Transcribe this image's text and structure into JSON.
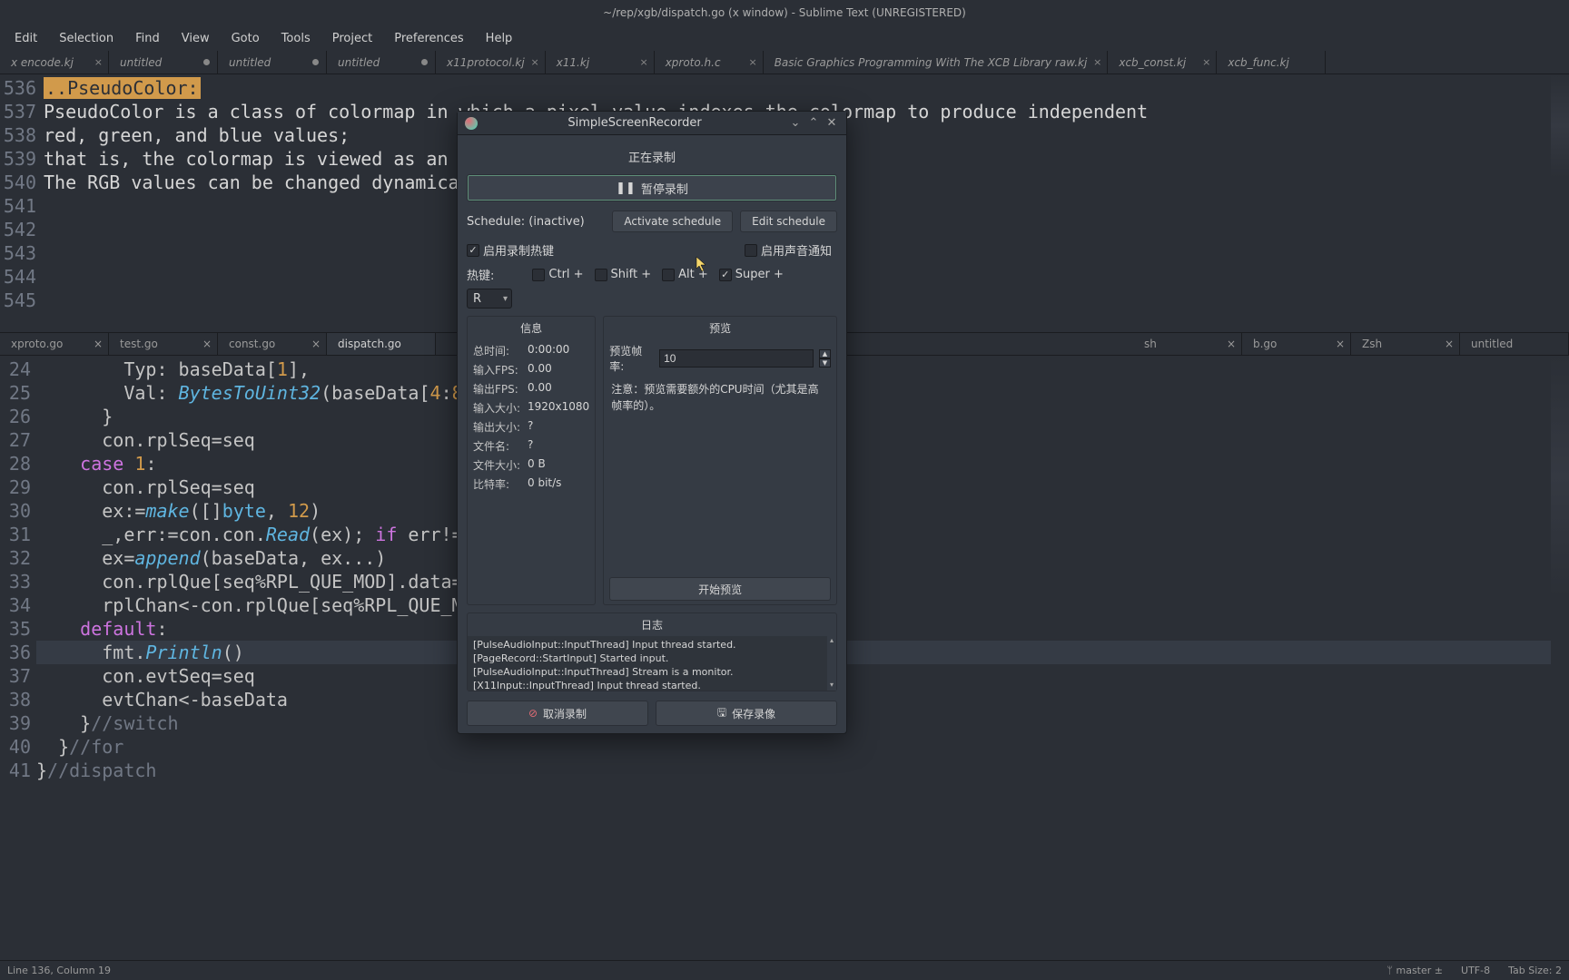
{
  "window_title": "~/rep/xgb/dispatch.go (x window) - Sublime Text (UNREGISTERED)",
  "menu": [
    "Edit",
    "Selection",
    "Find",
    "View",
    "Goto",
    "Tools",
    "Project",
    "Preferences",
    "Help"
  ],
  "tabs_top": [
    {
      "label": "x encode.kj",
      "close": "×"
    },
    {
      "label": "untitled",
      "dirty": true
    },
    {
      "label": "untitled",
      "dirty": true
    },
    {
      "label": "untitled",
      "dirty": true
    },
    {
      "label": "x11protocol.kj",
      "close": "×"
    },
    {
      "label": "x11.kj",
      "close": "×"
    },
    {
      "label": "xproto.h.c",
      "close": "×"
    },
    {
      "label": "Basic Graphics Programming With The XCB Library raw.kj",
      "close": "×"
    },
    {
      "label": "xcb_const.kj",
      "close": "×"
    },
    {
      "label": "xcb_func.kj"
    }
  ],
  "editor_top": {
    "gutter": [
      "536",
      "537",
      "538",
      "539",
      "540",
      "541",
      "542",
      "543",
      "",
      "544",
      "545"
    ],
    "lines": [
      "",
      "",
      "",
      "",
      "",
      "@HL@..PseudoColor:@HL@",
      "",
      "PseudoColor is a class of colormap in which a pixel value indexes the colormap to produce independent",
      "red, green, and blue values;",
      "that is, the colormap is viewed as an array of triples (RGB values).",
      "The RGB values can be changed dynamically."
    ]
  },
  "tabs_bottom": [
    {
      "label": "xproto.go",
      "close": "×"
    },
    {
      "label": "test.go",
      "close": "×"
    },
    {
      "label": "const.go",
      "close": "×"
    },
    {
      "label": "dispatch.go",
      "active": true
    },
    {
      "label": "",
      "spacer": true
    },
    {
      "label": "sh",
      "close": "×"
    },
    {
      "label": "b.go",
      "close": "×"
    },
    {
      "label": "Zsh",
      "close": "×"
    },
    {
      "label": "untitled"
    }
  ],
  "editor_bottom": {
    "gutter": [
      "24",
      "25",
      "26",
      "27",
      "28",
      "29",
      "30",
      "31",
      "32",
      "33",
      "34",
      "35",
      "36",
      "37",
      "38",
      "39",
      "40",
      "41"
    ],
    "lines_html": [
      "        Typ: baseData[<span class='tok-num'>1</span>],",
      "        Val: <span class='tok-fn'>BytesToUint32</span>(baseData[<span class='tok-num'>4</span>:<span class='tok-num'>8</span>]),",
      "      }",
      "      con.rplSeq=seq",
      "    <span class='tok-kw'>case</span> <span class='tok-num'>1</span>:",
      "      con.rplSeq=seq",
      "      ex:=<span class='tok-fn'>make</span>([]<span class='tok-type'>byte</span>, <span class='tok-num'>12</span>)",
      "      _,err:=con.con.<span class='tok-fn'>Read</span>(ex); <span class='tok-kw'>if</span> err!=nil{",
      "      ex=<span class='tok-fn'>append</span>(baseData, ex...)",
      "      con.rplQue[seq%RPL_QUE_MOD].data=ex",
      "      rplChan&lt;-con.rplQue[seq%RPL_QUE_MOD]",
      "    <span class='tok-kw'>default</span>:",
      "      fmt.<span class='tok-fn'>Println</span>()",
      "      con.evtSeq=seq",
      "      evtChan&lt;-baseData",
      "    }<span class='tok-cmt'>//switch</span>",
      "  }<span class='tok-cmt'>//for</span>",
      "}<span class='tok-cmt'>//dispatch</span>"
    ],
    "current_index": 12
  },
  "statusbar": {
    "left": "Line 136, Column 19",
    "branch": "master ±",
    "encoding": "UTF-8",
    "tabsize": "Tab Size: 2"
  },
  "dialog": {
    "title": "SimpleScreenRecorder",
    "header": "正在录制",
    "pause_btn": "暂停录制",
    "schedule_label": "Schedule: (inactive)",
    "activate": "Activate schedule",
    "edit": "Edit schedule",
    "enable_hotkey": "启用录制热键",
    "enable_sound": "启用声音通知",
    "hotkey_label": "热键:",
    "ctrl": "Ctrl +",
    "shift": "Shift +",
    "alt": "Alt +",
    "super": "Super +",
    "key": "R",
    "info_title": "信息",
    "info": {
      "k0": "总时间:",
      "v0": "0:00:00",
      "k1": "输入FPS:",
      "v1": "0.00",
      "k2": "输出FPS:",
      "v2": "0.00",
      "k3": "输入大小:",
      "v3": "1920x1080",
      "k4": "输出大小:",
      "v4": "?",
      "k5": "文件名:",
      "v5": "?",
      "k6": "文件大小:",
      "v6": "0 B",
      "k7": "比特率:",
      "v7": "0 bit/s"
    },
    "preview_title": "预览",
    "fps_label": "预览帧率:",
    "fps_value": "10",
    "preview_note": "注意：预览需要额外的CPU时间（尤其是高帧率的）。",
    "start_preview": "开始预览",
    "log_title": "日志",
    "log_lines": [
      "[X11Input::InputThread] Input thread started.",
      "[PulseAudioInput::InputThread] Stream is a monitor.",
      "[PageRecord::StartInput] Started input.",
      "[PulseAudioInput::InputThread] Input thread started."
    ],
    "cancel": "取消录制",
    "save": "保存录像"
  }
}
